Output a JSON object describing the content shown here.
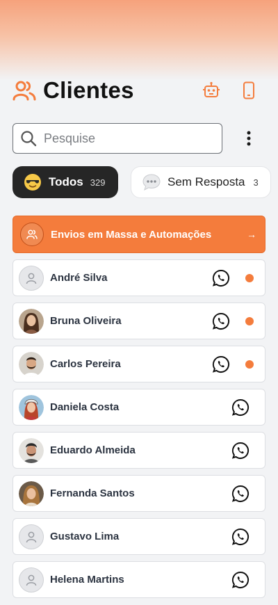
{
  "header": {
    "title": "Clientes",
    "title_icon": "users-icon",
    "actions": [
      "robot-icon",
      "smartphone-icon"
    ]
  },
  "search": {
    "placeholder": "Pesquise",
    "value": ""
  },
  "filters": [
    {
      "label": "Todos",
      "count": "329",
      "icon": "sunglasses-emoji-icon",
      "active": true
    },
    {
      "label": "Sem Resposta",
      "count": "3",
      "icon": "speech-bubble-emoji-icon",
      "active": false
    }
  ],
  "mass_banner": {
    "label": "Envios em Massa e Automações",
    "arrow": "→",
    "icon": "users-icon"
  },
  "colors": {
    "accent": "#f47c3c",
    "dark_chip": "#262626",
    "background": "#f2f3f5"
  },
  "clients": [
    {
      "name": "André Silva",
      "avatar": "placeholder",
      "unread": true
    },
    {
      "name": "Bruna Oliveira",
      "avatar": "photo",
      "unread": true
    },
    {
      "name": "Carlos Pereira",
      "avatar": "photo",
      "unread": true
    },
    {
      "name": "Daniela Costa",
      "avatar": "photo",
      "unread": false
    },
    {
      "name": "Eduardo Almeida",
      "avatar": "photo",
      "unread": false
    },
    {
      "name": "Fernanda Santos",
      "avatar": "photo",
      "unread": false
    },
    {
      "name": "Gustavo Lima",
      "avatar": "placeholder",
      "unread": false
    },
    {
      "name": "Helena Martins",
      "avatar": "placeholder",
      "unread": false
    }
  ]
}
